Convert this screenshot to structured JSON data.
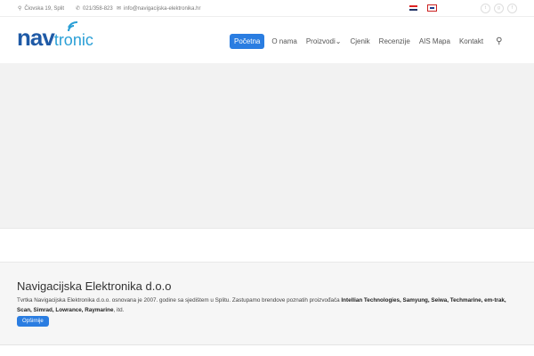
{
  "topbar": {
    "address": "Čiovska 19, Split",
    "phone": "021/358-823",
    "email": "info@navigacijska-elektronika.hr",
    "languages": [
      "Hrvatski",
      "English"
    ],
    "social": [
      "twitter",
      "google-plus",
      "facebook"
    ]
  },
  "logo": {
    "part1": "nav",
    "part2": "tronic"
  },
  "nav": [
    "Početna",
    "O nama",
    "Proizvodi",
    "Cjenik",
    "Recenzije",
    "AIS Mapa",
    "Kontakt"
  ],
  "about": {
    "title": "Navigacijska Elektronika d.o.o",
    "text": "Tvrtka Navigacijska Elektronika d.o.o. osnovana je 2007. godine sa sjedištem u Splitu. Zastupamo brendove poznatih proizvođača ",
    "brands": "Intellian Technologies, Samyung, Seiwa, Techmarine, em-trak, Scan, Simrad, Lowrance, Raymarine",
    "suffix": ", itd.",
    "button": "Opširnije"
  },
  "colors": {
    "accent": "#2a7de1"
  }
}
